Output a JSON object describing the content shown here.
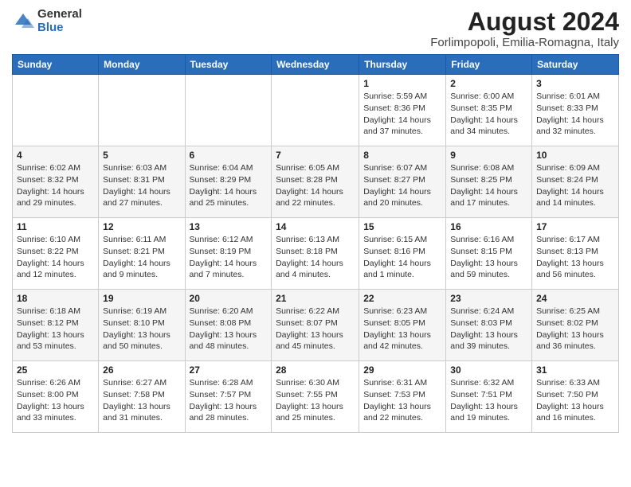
{
  "header": {
    "logo_general": "General",
    "logo_blue": "Blue",
    "month_year": "August 2024",
    "location": "Forlimpopoli, Emilia-Romagna, Italy"
  },
  "columns": [
    "Sunday",
    "Monday",
    "Tuesday",
    "Wednesday",
    "Thursday",
    "Friday",
    "Saturday"
  ],
  "weeks": [
    [
      {
        "day": "",
        "info": ""
      },
      {
        "day": "",
        "info": ""
      },
      {
        "day": "",
        "info": ""
      },
      {
        "day": "",
        "info": ""
      },
      {
        "day": "1",
        "info": "Sunrise: 5:59 AM\nSunset: 8:36 PM\nDaylight: 14 hours\nand 37 minutes."
      },
      {
        "day": "2",
        "info": "Sunrise: 6:00 AM\nSunset: 8:35 PM\nDaylight: 14 hours\nand 34 minutes."
      },
      {
        "day": "3",
        "info": "Sunrise: 6:01 AM\nSunset: 8:33 PM\nDaylight: 14 hours\nand 32 minutes."
      }
    ],
    [
      {
        "day": "4",
        "info": "Sunrise: 6:02 AM\nSunset: 8:32 PM\nDaylight: 14 hours\nand 29 minutes."
      },
      {
        "day": "5",
        "info": "Sunrise: 6:03 AM\nSunset: 8:31 PM\nDaylight: 14 hours\nand 27 minutes."
      },
      {
        "day": "6",
        "info": "Sunrise: 6:04 AM\nSunset: 8:29 PM\nDaylight: 14 hours\nand 25 minutes."
      },
      {
        "day": "7",
        "info": "Sunrise: 6:05 AM\nSunset: 8:28 PM\nDaylight: 14 hours\nand 22 minutes."
      },
      {
        "day": "8",
        "info": "Sunrise: 6:07 AM\nSunset: 8:27 PM\nDaylight: 14 hours\nand 20 minutes."
      },
      {
        "day": "9",
        "info": "Sunrise: 6:08 AM\nSunset: 8:25 PM\nDaylight: 14 hours\nand 17 minutes."
      },
      {
        "day": "10",
        "info": "Sunrise: 6:09 AM\nSunset: 8:24 PM\nDaylight: 14 hours\nand 14 minutes."
      }
    ],
    [
      {
        "day": "11",
        "info": "Sunrise: 6:10 AM\nSunset: 8:22 PM\nDaylight: 14 hours\nand 12 minutes."
      },
      {
        "day": "12",
        "info": "Sunrise: 6:11 AM\nSunset: 8:21 PM\nDaylight: 14 hours\nand 9 minutes."
      },
      {
        "day": "13",
        "info": "Sunrise: 6:12 AM\nSunset: 8:19 PM\nDaylight: 14 hours\nand 7 minutes."
      },
      {
        "day": "14",
        "info": "Sunrise: 6:13 AM\nSunset: 8:18 PM\nDaylight: 14 hours\nand 4 minutes."
      },
      {
        "day": "15",
        "info": "Sunrise: 6:15 AM\nSunset: 8:16 PM\nDaylight: 14 hours\nand 1 minute."
      },
      {
        "day": "16",
        "info": "Sunrise: 6:16 AM\nSunset: 8:15 PM\nDaylight: 13 hours\nand 59 minutes."
      },
      {
        "day": "17",
        "info": "Sunrise: 6:17 AM\nSunset: 8:13 PM\nDaylight: 13 hours\nand 56 minutes."
      }
    ],
    [
      {
        "day": "18",
        "info": "Sunrise: 6:18 AM\nSunset: 8:12 PM\nDaylight: 13 hours\nand 53 minutes."
      },
      {
        "day": "19",
        "info": "Sunrise: 6:19 AM\nSunset: 8:10 PM\nDaylight: 13 hours\nand 50 minutes."
      },
      {
        "day": "20",
        "info": "Sunrise: 6:20 AM\nSunset: 8:08 PM\nDaylight: 13 hours\nand 48 minutes."
      },
      {
        "day": "21",
        "info": "Sunrise: 6:22 AM\nSunset: 8:07 PM\nDaylight: 13 hours\nand 45 minutes."
      },
      {
        "day": "22",
        "info": "Sunrise: 6:23 AM\nSunset: 8:05 PM\nDaylight: 13 hours\nand 42 minutes."
      },
      {
        "day": "23",
        "info": "Sunrise: 6:24 AM\nSunset: 8:03 PM\nDaylight: 13 hours\nand 39 minutes."
      },
      {
        "day": "24",
        "info": "Sunrise: 6:25 AM\nSunset: 8:02 PM\nDaylight: 13 hours\nand 36 minutes."
      }
    ],
    [
      {
        "day": "25",
        "info": "Sunrise: 6:26 AM\nSunset: 8:00 PM\nDaylight: 13 hours\nand 33 minutes."
      },
      {
        "day": "26",
        "info": "Sunrise: 6:27 AM\nSunset: 7:58 PM\nDaylight: 13 hours\nand 31 minutes."
      },
      {
        "day": "27",
        "info": "Sunrise: 6:28 AM\nSunset: 7:57 PM\nDaylight: 13 hours\nand 28 minutes."
      },
      {
        "day": "28",
        "info": "Sunrise: 6:30 AM\nSunset: 7:55 PM\nDaylight: 13 hours\nand 25 minutes."
      },
      {
        "day": "29",
        "info": "Sunrise: 6:31 AM\nSunset: 7:53 PM\nDaylight: 13 hours\nand 22 minutes."
      },
      {
        "day": "30",
        "info": "Sunrise: 6:32 AM\nSunset: 7:51 PM\nDaylight: 13 hours\nand 19 minutes."
      },
      {
        "day": "31",
        "info": "Sunrise: 6:33 AM\nSunset: 7:50 PM\nDaylight: 13 hours\nand 16 minutes."
      }
    ]
  ]
}
